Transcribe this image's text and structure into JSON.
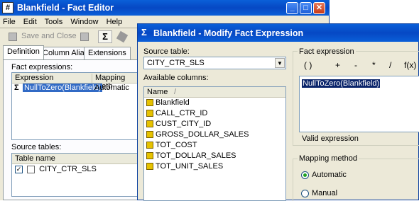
{
  "fact_editor": {
    "title": "Blankfield - Fact Editor",
    "title_icon": "#",
    "menu": [
      "File",
      "Edit",
      "Tools",
      "Window",
      "Help"
    ],
    "toolbar": {
      "save_and_close": "Save and Close"
    },
    "tabs": [
      "Definition",
      "Column Alias",
      "Extensions"
    ],
    "fact_expressions_label": "Fact expressions:",
    "columns": [
      "Expression",
      "Mapping meth"
    ],
    "rows": [
      {
        "expression": "NullToZero(Blankfield)",
        "mapping": "Automatic"
      }
    ],
    "source_tables_label": "Source tables:",
    "table_header": "Table name",
    "tables": [
      "CITY_CTR_SLS"
    ]
  },
  "modify_dialog": {
    "title": "Blankfield - Modify Fact Expression",
    "source_table_label": "Source table:",
    "source_table_value": "CITY_CTR_SLS",
    "available_columns_label": "Available columns:",
    "name_header": "Name",
    "columns": [
      "Blankfield",
      "CALL_CTR_ID",
      "CUST_CITY_ID",
      "GROSS_DOLLAR_SALES",
      "TOT_COST",
      "TOT_DOLLAR_SALES",
      "TOT_UNIT_SALES"
    ],
    "fact_expression_label": "Fact expression",
    "operators": [
      "( )",
      "+",
      "-",
      "*",
      "/",
      "f(x)"
    ],
    "expression": "NullToZero(Blankfield)",
    "status": "Valid expression",
    "mapping_label": "Mapping method",
    "mapping_options": [
      "Automatic",
      "Manual"
    ],
    "mapping_selected": "Automatic"
  },
  "colors": {
    "titlebar": "#0a5fd8",
    "selection": "#316ac5",
    "window_bg": "#ece9d8"
  }
}
